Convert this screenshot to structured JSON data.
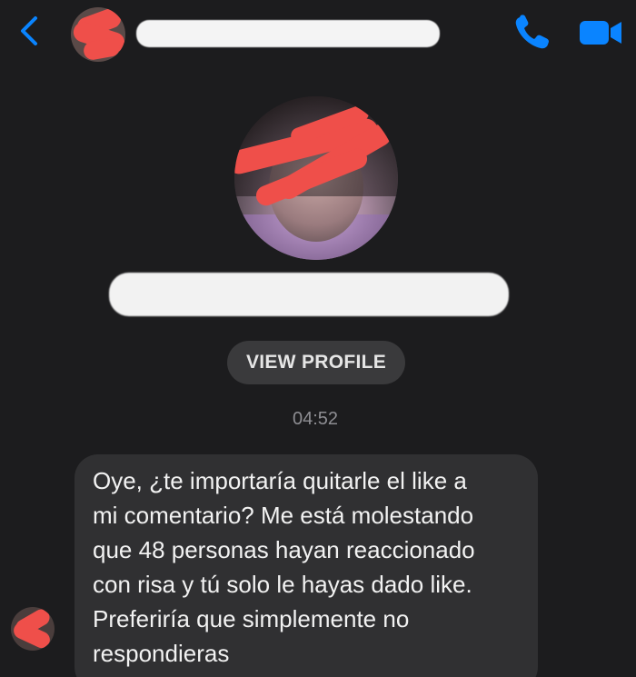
{
  "header": {
    "back_icon": "chevron-left-icon",
    "call_icon": "phone-icon",
    "video_icon": "video-camera-icon",
    "accent_color": "#0a84ff"
  },
  "profile": {
    "view_profile_label": "VIEW PROFILE"
  },
  "conversation": {
    "timestamp": "04:52",
    "message_lines": [
      "Oye, ¿te importaría quitarle el like a",
      "mi comentario? Me está molestando",
      "que 48 personas hayan reaccionado",
      "con risa y tú solo le hayas dado like.",
      "Preferiría que simplemente no",
      "respondieras"
    ]
  },
  "colors": {
    "background": "#1c1c1e",
    "bubble": "#303032",
    "redaction_red": "#ef4f4a",
    "redaction_white": "#f2f2f2"
  }
}
